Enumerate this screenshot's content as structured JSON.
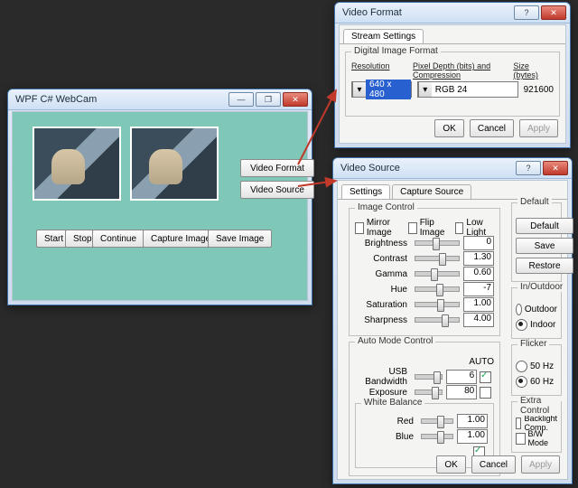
{
  "main": {
    "title": "WPF C# WebCam",
    "buttons": {
      "start": "Start",
      "stop": "Stop",
      "continue": "Continue",
      "capture": "Capture Image",
      "saveimg": "Save Image",
      "vformat": "Video Format",
      "vsource": "Video Source"
    }
  },
  "format": {
    "title": "Video Format",
    "tab_stream": "Stream Settings",
    "group": "Digital Image Format",
    "hdr_res": "Resolution",
    "hdr_depth": "Pixel Depth (bits) and Compression",
    "hdr_size": "Size (bytes)",
    "res_value": "640 x 480",
    "depth_value": "RGB 24",
    "size_value": "921600",
    "ok": "OK",
    "cancel": "Cancel",
    "apply": "Apply"
  },
  "source": {
    "title": "Video Source",
    "tab_settings": "Settings",
    "tab_capture": "Capture Source",
    "image_control": "Image Control",
    "mirror": "Mirror Image",
    "flip": "Flip Image",
    "lowlight": "Low Light",
    "params": {
      "brightness": {
        "label": "Brightness",
        "value": "0",
        "thumb": 40
      },
      "contrast": {
        "label": "Contrast",
        "value": "1.30",
        "thumb": 55
      },
      "gamma": {
        "label": "Gamma",
        "value": "0.60",
        "thumb": 35
      },
      "hue": {
        "label": "Hue",
        "value": "-7",
        "thumb": 48
      },
      "saturation": {
        "label": "Saturation",
        "value": "1.00",
        "thumb": 50
      },
      "sharpness": {
        "label": "Sharpness",
        "value": "4.00",
        "thumb": 60
      }
    },
    "auto_mode": "Auto Mode Control",
    "auto_label": "AUTO",
    "usb": {
      "label": "USB Bandwidth",
      "value": "6",
      "thumb": 70
    },
    "exposure": {
      "label": "Exposure",
      "value": "80",
      "thumb": 60
    },
    "wb": "White Balance",
    "red": {
      "label": "Red",
      "value": "1.00",
      "thumb": 50
    },
    "blue": {
      "label": "Blue",
      "value": "1.00",
      "thumb": 50
    },
    "default_group": "Default",
    "btn_default": "Default",
    "btn_save": "Save",
    "btn_restore": "Restore",
    "inout": "In/Outdoor",
    "outdoor": "Outdoor",
    "indoor": "Indoor",
    "flicker": "Flicker",
    "hz50": "50 Hz",
    "hz60": "60 Hz",
    "extra": "Extra Control",
    "backlight": "Backlight Comp.",
    "bw": "B/W Mode",
    "ok": "OK",
    "cancel": "Cancel",
    "apply": "Apply"
  },
  "win_icons": {
    "min": "—",
    "max": "❐",
    "close": "✕",
    "help": "?"
  }
}
